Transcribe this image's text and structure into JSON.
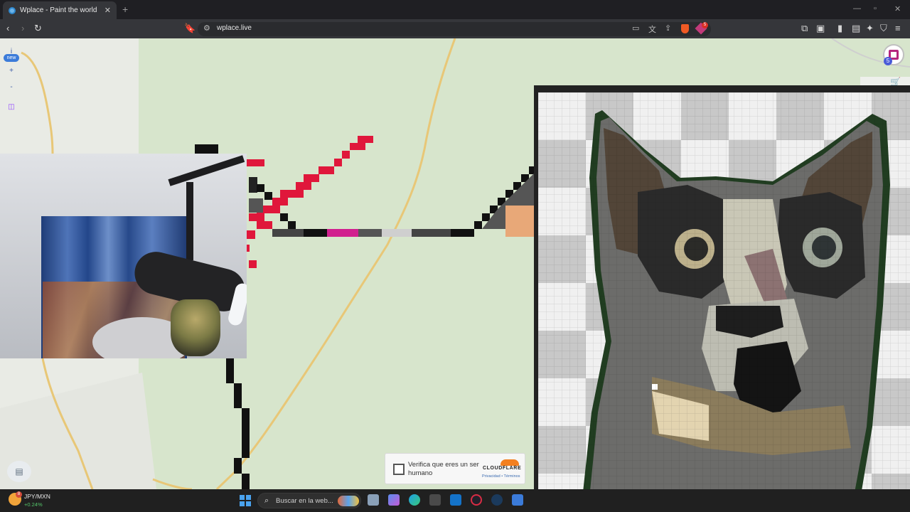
{
  "browser": {
    "tab_title": "Wplace - Paint the world",
    "url": "wplace.live",
    "tab_close": "✕",
    "new_tab": "+"
  },
  "map": {
    "info_button": "i",
    "new_badge": "new",
    "zoom_in": "+",
    "zoom_out": "-",
    "notification_count": "5"
  },
  "captcha": {
    "label": "Verifica que eres un ser humano",
    "brand": "CLOUDFLARE",
    "links": "Privacidad • Términos"
  },
  "taskbar": {
    "ticker_pair": "JPY/MXN",
    "ticker_change": "+0.24%",
    "search_placeholder": "Buscar en la web...",
    "weather_badge": "8"
  },
  "toolbar": {
    "extension_badge": "5"
  },
  "colors": {
    "map_green": "#d7e5cc",
    "pixel_red": "#e0173b",
    "pixel_magenta": "#d11f8e",
    "accent_blue": "#3b7bd9"
  }
}
